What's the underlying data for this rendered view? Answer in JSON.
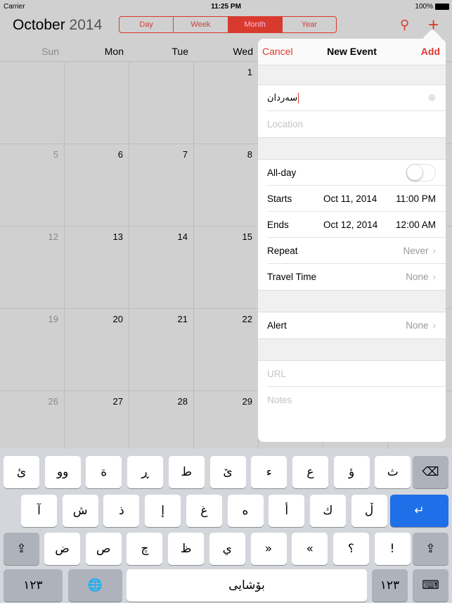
{
  "status": {
    "carrier": "Carrier",
    "time": "11:25 PM",
    "battery": "100%"
  },
  "header": {
    "month": "October",
    "year": "2014",
    "views": [
      "Day",
      "Week",
      "Month",
      "Year"
    ],
    "active_view": "Month",
    "accent": "#d93a2e"
  },
  "weekdays": [
    "Sun",
    "Mon",
    "Tue",
    "Wed"
  ],
  "weeks": [
    [
      "",
      "",
      "",
      "1"
    ],
    [
      "5",
      "6",
      "7",
      "8"
    ],
    [
      "12",
      "13",
      "14",
      "15"
    ],
    [
      "19",
      "20",
      "21",
      "22"
    ],
    [
      "26",
      "27",
      "28",
      "29"
    ]
  ],
  "popover": {
    "cancel": "Cancel",
    "title": "New Event",
    "add": "Add",
    "event_title": "سەردان",
    "location_placeholder": "Location",
    "all_day": "All-day",
    "all_day_on": false,
    "starts_label": "Starts",
    "starts_date": "Oct 11, 2014",
    "starts_time": "11:00 PM",
    "ends_label": "Ends",
    "ends_date": "Oct 12, 2014",
    "ends_time": "12:00 AM",
    "repeat_label": "Repeat",
    "repeat_value": "Never",
    "travel_label": "Travel Time",
    "travel_value": "None",
    "alert_label": "Alert",
    "alert_value": "None",
    "url_placeholder": "URL",
    "notes_placeholder": "Notes"
  },
  "keyboard": {
    "row1": [
      "ئ",
      "وو",
      "ة",
      "ڕ",
      "ط",
      "ێ",
      "ء",
      "ع",
      "ؤ",
      "ث"
    ],
    "row2": [
      "آ",
      "ش",
      "ذ",
      "إ",
      "غ",
      "ه",
      "أ",
      "ك",
      "ڵ"
    ],
    "row3": [
      "ض",
      "ص",
      "چ",
      "ظ",
      "ي",
      "»",
      "«",
      "؟",
      "!"
    ],
    "numbers": "١٢٣",
    "space": "بۆشایی"
  }
}
